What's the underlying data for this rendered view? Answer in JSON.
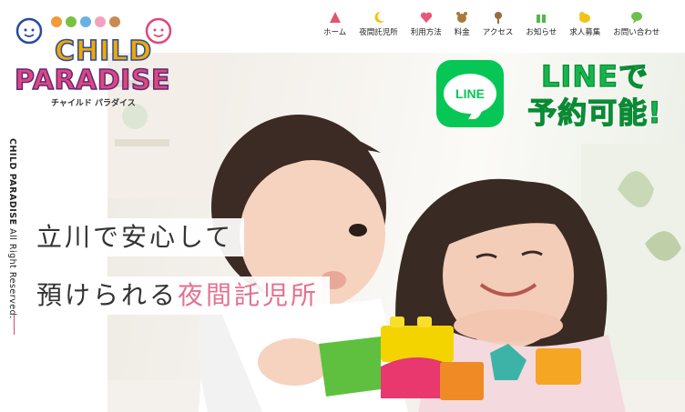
{
  "brand": {
    "logo_line1": "CHILD",
    "logo_line2": "PARADISE",
    "logo_kana": "チャイルド パラダイス"
  },
  "nav": {
    "items": [
      {
        "label": "ホーム",
        "icon": "house-tent-icon",
        "color": "#e0566f"
      },
      {
        "label": "夜間託児所",
        "icon": "crescent-moon-icon",
        "color": "#f2c500"
      },
      {
        "label": "利用方法",
        "icon": "heart-icon",
        "color": "#e9577a"
      },
      {
        "label": "料金",
        "icon": "bear-face-icon",
        "color": "#a77a3c"
      },
      {
        "label": "アクセス",
        "icon": "flower-pin-icon",
        "color": "#9a6b3d"
      },
      {
        "label": "お知らせ",
        "icon": "gift-box-icon",
        "color": "#52b848"
      },
      {
        "label": "求人募集",
        "icon": "bird-icon",
        "color": "#f1c21a"
      },
      {
        "label": "お問い合わせ",
        "icon": "speech-bubble-icon",
        "color": "#6cc04a"
      }
    ]
  },
  "side": {
    "brand": "CHILD PARADISE",
    "rights": " All Right Reserved."
  },
  "hero": {
    "copy_line1": "立川で安心して",
    "copy_line2_main": "預けられる",
    "copy_line2_accent": "夜間託児所"
  },
  "line_banner": {
    "badge_text": "LINE",
    "text_line1": "LINEで",
    "text_line2": "予約可能!",
    "color": "#06c755"
  }
}
